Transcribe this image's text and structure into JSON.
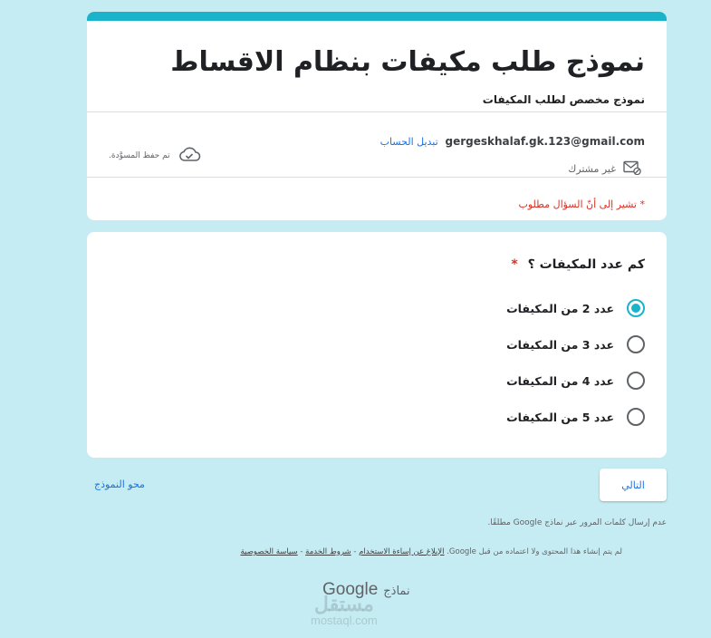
{
  "form": {
    "title": "نموذج طلب مكيفات بنظام الاقساط",
    "description": "نموذج مخصص لطلب المكيفات"
  },
  "account": {
    "email": "gergeskhalaf.gk.123@gmail.com",
    "switch_label": "تبديل الحساب",
    "not_shared": "غير مشترك",
    "draft_saved": "تم حفظ المسوَّدة."
  },
  "required_note": "* تشير إلى أنّ السؤال مطلوب",
  "question": {
    "title": "كم عدد المكيفات ؟",
    "required_mark": "*",
    "options": [
      {
        "label": "عدد 2 من المكيفات",
        "selected": true
      },
      {
        "label": "عدد 3 من المكيفات",
        "selected": false
      },
      {
        "label": "عدد 4 من المكيفات",
        "selected": false
      },
      {
        "label": "عدد 5 من المكيفات",
        "selected": false
      }
    ]
  },
  "nav": {
    "next_label": "التالي",
    "clear_label": "محو النموذج"
  },
  "footer": {
    "password_note": "عدم إرسال كلمات المرور عبر نماذج Google مطلقًا.",
    "disclaimer": "لم يتم إنشاء هذا المحتوى ولا اعتماده من قبل Google.",
    "report_link": "الإبلاغ عن إساءة الاستخدام",
    "terms_link": "شروط الخدمة",
    "privacy_link": "سياسة الخصوصية",
    "separator": " - ",
    "brand_google": "Google",
    "brand_forms": "نماذج"
  },
  "watermark": {
    "arabic": "مستقل",
    "latin": "mostaql.com"
  },
  "colors": {
    "background": "#c5ecf2",
    "accent": "#19b3ca",
    "link": "#1a73e8",
    "required": "#d93025"
  },
  "icons": {
    "cloud": "cloud-check-icon",
    "mail": "mail-blocked-icon"
  }
}
